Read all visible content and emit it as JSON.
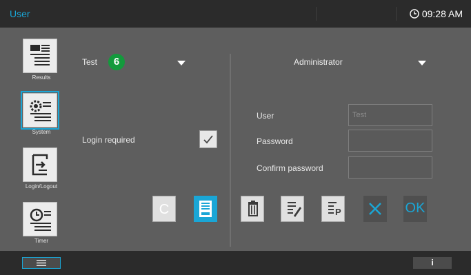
{
  "header": {
    "title": "User",
    "time": "09:28 AM"
  },
  "sidebar": {
    "items": [
      {
        "label": "Results",
        "icon": "results-icon"
      },
      {
        "label": "System",
        "icon": "system-icon",
        "selected": true
      },
      {
        "label": "Login/Logout",
        "icon": "login-logout-icon"
      },
      {
        "label": "Timer",
        "icon": "timer-icon"
      }
    ]
  },
  "form": {
    "user_select": "Test",
    "badge": "6",
    "role_select": "Administrator",
    "login_required_label": "Login required",
    "login_required_checked": true,
    "user_label": "User",
    "user_value": "Test",
    "password_label": "Password",
    "confirm_password_label": "Confirm password"
  },
  "toolbar": {
    "clear_label": "C",
    "ok_label": "OK"
  },
  "colors": {
    "accent": "#1aa6d6",
    "badge": "#139a3c",
    "background": "#5e5e5e",
    "bar": "#2b2b2b"
  }
}
